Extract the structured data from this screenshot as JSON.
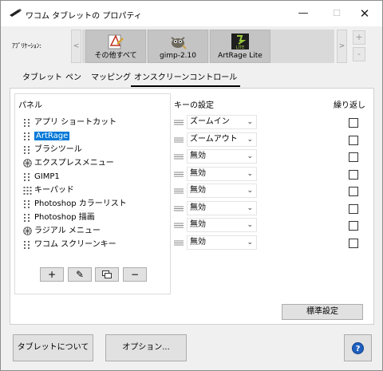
{
  "window": {
    "title": "ワコム タブレットの プロパティ",
    "minimize_glyph": "—",
    "maximize_glyph": "☐",
    "close_glyph": "✕"
  },
  "application_bar": {
    "label": "ｱﾌﾟﾘｹｰｼｮﾝ:",
    "scroll_left_glyph": "<",
    "scroll_right_glyph": ">",
    "add_glyph": "+",
    "remove_glyph": "-",
    "apps": [
      {
        "name": "その他すべて",
        "icon": "all-apps-icon",
        "selected": false
      },
      {
        "name": "gimp-2.10",
        "icon": "gimp-icon",
        "selected": false
      },
      {
        "name": "ArtRage Lite",
        "icon": "artrage-lite-icon",
        "selected": true
      }
    ]
  },
  "tabs": [
    {
      "label": "タブレット",
      "active": false
    },
    {
      "label": "ペン",
      "active": false
    },
    {
      "label": "マッピング",
      "active": false
    },
    {
      "label": "オンスクリーンコントロール",
      "active": true
    }
  ],
  "panel": {
    "header": "パネル",
    "items": [
      {
        "label": "アプリ ショートカット",
        "icon": "drag-grip-icon",
        "selected": false
      },
      {
        "label": "ArtRage",
        "icon": "drag-grip-icon",
        "selected": true
      },
      {
        "label": "ブラシツール",
        "icon": "drag-grip-icon",
        "selected": false
      },
      {
        "label": "エクスプレスメニュー",
        "icon": "radial-menu-icon",
        "selected": false
      },
      {
        "label": "GIMP1",
        "icon": "drag-grip-icon",
        "selected": false
      },
      {
        "label": "キーパッド",
        "icon": "keypad-grid-icon",
        "selected": false
      },
      {
        "label": "Photoshop カラーリスト",
        "icon": "drag-grip-icon",
        "selected": false
      },
      {
        "label": "Photoshop 描画",
        "icon": "drag-grip-icon",
        "selected": false
      },
      {
        "label": "ラジアル メニュー",
        "icon": "radial-menu-icon",
        "selected": false
      },
      {
        "label": "ワコム スクリーンキー",
        "icon": "drag-grip-icon",
        "selected": false
      }
    ],
    "tools": [
      {
        "name": "add",
        "glyph": "+"
      },
      {
        "name": "edit",
        "glyph": "✎"
      },
      {
        "name": "duplicate",
        "glyph": "⧉"
      },
      {
        "name": "remove",
        "glyph": "−"
      }
    ]
  },
  "keys": {
    "header": "キーの設定",
    "repeat_header": "繰り返し",
    "chevron_glyph": "⌄",
    "rows": [
      {
        "value": "ズームイン",
        "repeat": false
      },
      {
        "value": "ズームアウト",
        "repeat": false
      },
      {
        "value": "無効",
        "repeat": false
      },
      {
        "value": "無効",
        "repeat": false
      },
      {
        "value": "無効",
        "repeat": false
      },
      {
        "value": "無効",
        "repeat": false
      },
      {
        "value": "無効",
        "repeat": false
      },
      {
        "value": "無効",
        "repeat": false
      }
    ],
    "reset_label": "標準設定"
  },
  "footer": {
    "about_label": "タブレットについて",
    "options_label": "オプション...",
    "help_glyph": "?"
  }
}
